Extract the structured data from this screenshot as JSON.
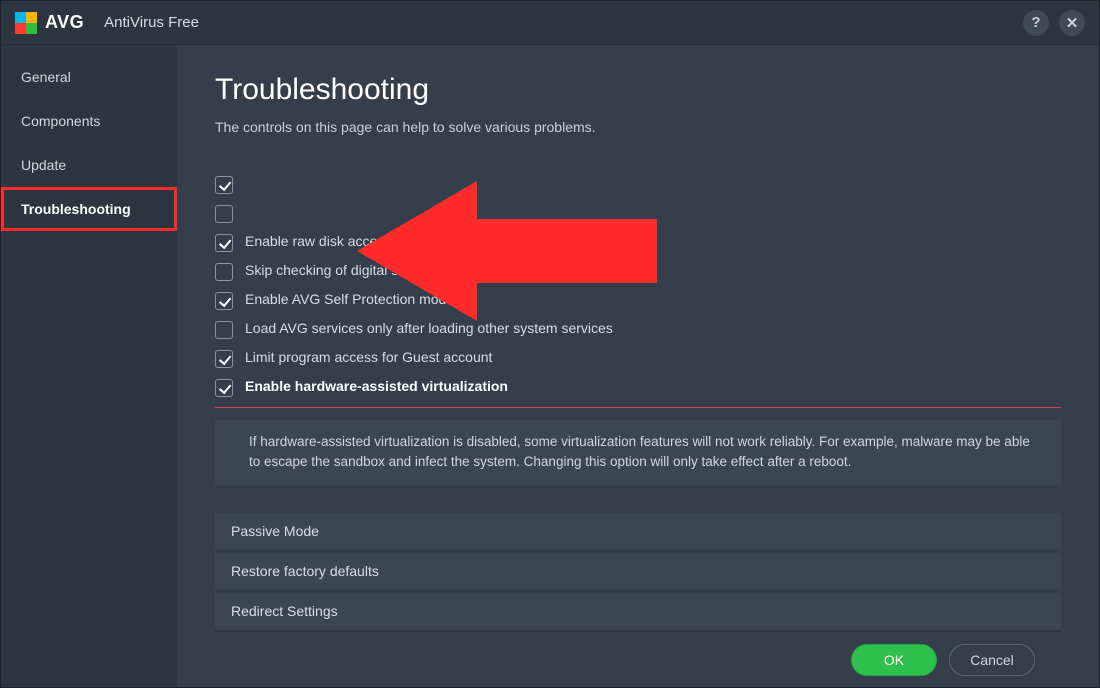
{
  "titlebar": {
    "brand": "AVG",
    "product": "AntiVirus Free"
  },
  "sidebar": {
    "items": [
      {
        "label": "General"
      },
      {
        "label": "Components"
      },
      {
        "label": "Update"
      },
      {
        "label": "Troubleshooting"
      }
    ],
    "active_index": 3
  },
  "page": {
    "title": "Troubleshooting",
    "subtitle": "The controls on this page can help to solve various problems."
  },
  "options": [
    {
      "checked": true,
      "label": "",
      "bold": false
    },
    {
      "checked": false,
      "label": "",
      "bold": false
    },
    {
      "checked": true,
      "label": "Enable raw disk access during AVG boot-time scan",
      "bold": false
    },
    {
      "checked": false,
      "label": "Skip checking of digital signatures of infected files",
      "bold": false
    },
    {
      "checked": true,
      "label": "Enable AVG Self Protection module",
      "bold": false
    },
    {
      "checked": false,
      "label": "Load AVG services only after loading other system services",
      "bold": false
    },
    {
      "checked": true,
      "label": "Limit program access for Guest account",
      "bold": false
    },
    {
      "checked": true,
      "label": "Enable hardware-assisted virtualization",
      "bold": true
    }
  ],
  "info_text": "If hardware-assisted virtualization is disabled, some virtualization features will not work reliably. For example, malware may be able to escape the sandbox and infect the system. Changing this option will only take effect after a reboot.",
  "sections": [
    {
      "label": "Passive Mode"
    },
    {
      "label": "Restore factory defaults"
    },
    {
      "label": "Redirect Settings"
    }
  ],
  "buttons": {
    "ok": "OK",
    "cancel": "Cancel"
  },
  "colors": {
    "highlight_red": "#ff2a2a",
    "ok_green": "#2fbf4c"
  }
}
